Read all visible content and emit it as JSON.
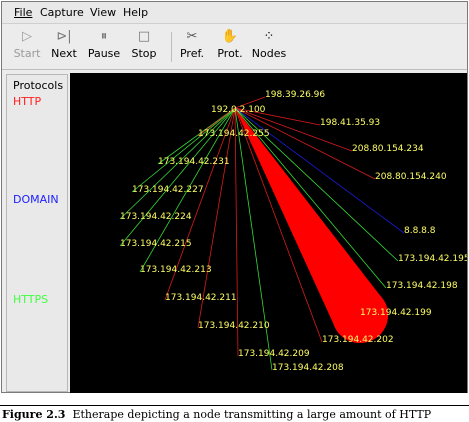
{
  "menu": [
    {
      "label": "File"
    },
    {
      "label": "Capture"
    },
    {
      "label": "View"
    },
    {
      "label": "Help"
    }
  ],
  "toolbar": {
    "start": {
      "label": "Start",
      "icon": "play-icon",
      "enabled": false
    },
    "next": {
      "label": "Next",
      "icon": "step-next-icon",
      "enabled": true
    },
    "pause": {
      "label": "Pause",
      "icon": "pause-icon",
      "enabled": true
    },
    "stop": {
      "label": "Stop",
      "icon": "stop-icon",
      "enabled": true
    },
    "pref": {
      "label": "Pref.",
      "icon": "tools-icon",
      "enabled": true
    },
    "prot": {
      "label": "Prot.",
      "icon": "protocol-icon",
      "enabled": true
    },
    "nodes": {
      "label": "Nodes",
      "icon": "nodes-icon",
      "enabled": true
    }
  },
  "protocols": {
    "title": "Protocols",
    "items": [
      {
        "label": "HTTP",
        "color": "#ff2020"
      },
      {
        "label": "DOMAIN",
        "color": "#2020ff"
      },
      {
        "label": "HTTPS",
        "color": "#40ff40"
      }
    ]
  },
  "graph": {
    "center": "192.0.2.100",
    "nodes": [
      {
        "label": "198.39.26.96",
        "protocol": "HTTP"
      },
      {
        "label": "198.41.35.93",
        "protocol": "HTTP"
      },
      {
        "label": "208.80.154.234",
        "protocol": "HTTP"
      },
      {
        "label": "208.80.154.240",
        "protocol": "HTTP"
      },
      {
        "label": "8.8.8.8",
        "protocol": "DOMAIN"
      },
      {
        "label": "173.194.42.195",
        "protocol": "HTTPS"
      },
      {
        "label": "173.194.42.198",
        "protocol": "HTTPS"
      },
      {
        "label": "173.194.42.199",
        "protocol": "HTTP"
      },
      {
        "label": "173.194.42.202",
        "protocol": "HTTP"
      },
      {
        "label": "173.194.42.208",
        "protocol": "HTTPS"
      },
      {
        "label": "173.194.42.209",
        "protocol": "HTTP"
      },
      {
        "label": "173.194.42.210",
        "protocol": "HTTP"
      },
      {
        "label": "173.194.42.211",
        "protocol": "HTTP"
      },
      {
        "label": "173.194.42.213",
        "protocol": "HTTPS"
      },
      {
        "label": "173.194.42.215",
        "protocol": "HTTPS"
      },
      {
        "label": "173.194.42.224",
        "protocol": "HTTPS"
      },
      {
        "label": "173.194.42.227",
        "protocol": "HTTPS"
      },
      {
        "label": "173.194.42.231",
        "protocol": "HTTPS"
      },
      {
        "label": "173.194.42.255",
        "protocol": "HTTP"
      }
    ]
  },
  "caption": {
    "bold": "Figure 2.3",
    "text": "Etherape depicting a node transmitting a large amount of HTTP"
  }
}
